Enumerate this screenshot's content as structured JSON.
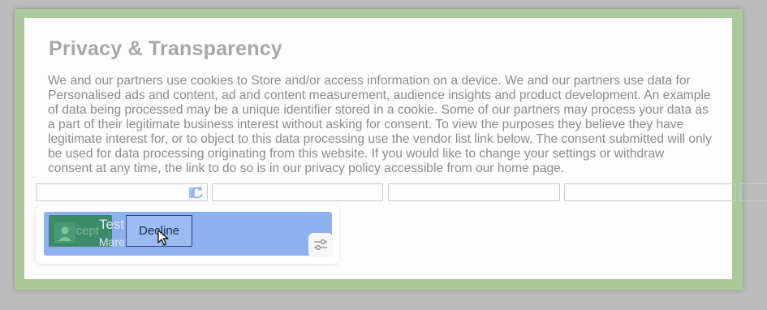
{
  "dialog": {
    "title": "Privacy & Transparency",
    "body": "We and our partners use cookies to Store and/or access information on a device. We and our partners use data for Personalised ads and content, ad and content measurement, audience insights and product development. An example of data being processed may be a unique identifier stored in a cookie. Some of our partners may process your data as a part of their legitimate business interest without asking for consent. To view the purposes they believe they have legitimate interest for, or to object to this data processing use the vendor list link below. The consent submitted will only be used for data processing originating from this website. If you would like to change your settings or withdraw consent at any time, the link to do so is in our privacy policy accessible from our home page."
  },
  "buttons": {
    "accept_label": "Accept",
    "decline_label": "Decline"
  },
  "card": {
    "title": "Test Test",
    "subtitle": "Marek Totla"
  },
  "icons": {
    "refresh": "refresh-icon",
    "settings": "sliders-icon",
    "cursor": "mouse-pointer-icon",
    "avatar": "avatar-icon"
  },
  "colors": {
    "frame": "#a9c99a",
    "card": "#8fb0ef",
    "accept": "#3b8a6a",
    "title_text": "#a7a7a7",
    "body_text": "#8b8b8b"
  }
}
